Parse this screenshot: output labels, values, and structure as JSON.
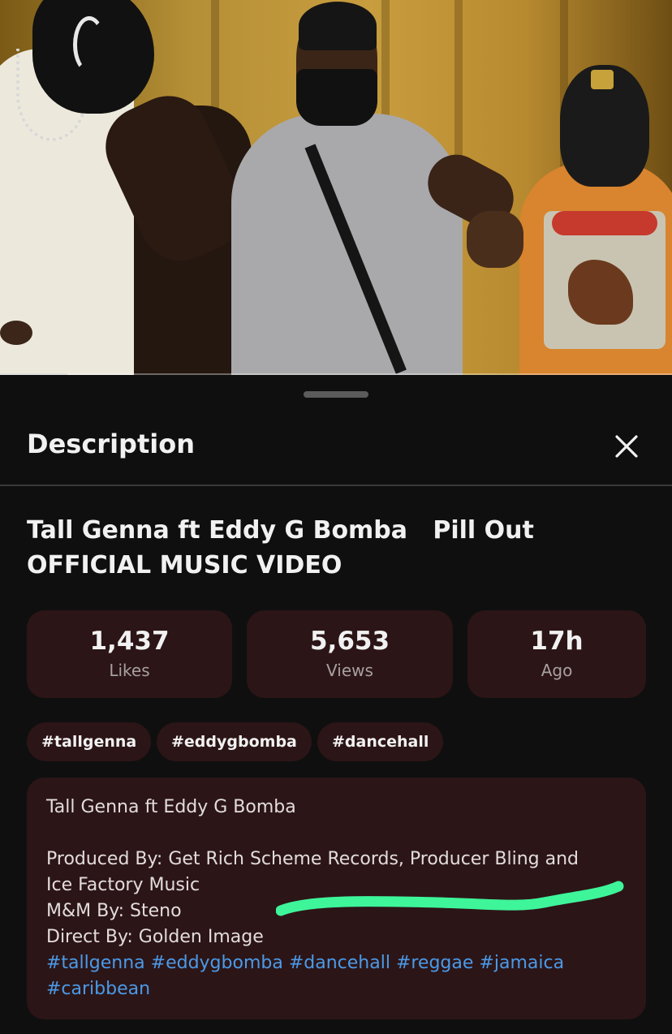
{
  "video": {
    "progress": 0.1
  },
  "sheet": {
    "title": "Description",
    "close_icon": "close-icon"
  },
  "video_title": "Tall Genna ft Eddy G Bomba   Pill Out OFFICIAL MUSIC VIDEO",
  "stats": [
    {
      "value": "1,437",
      "label": "Likes"
    },
    {
      "value": "5,653",
      "label": "Views"
    },
    {
      "value": "17h",
      "label": "Ago"
    }
  ],
  "tags": [
    "#tallgenna",
    "#eddygbomba",
    "#dancehall"
  ],
  "description": {
    "line1": "Tall Genna ft Eddy G Bomba",
    "line2": "Produced By: Get Rich Scheme Records, Producer Bling and",
    "line3": "Ice Factory Music",
    "line4": "M&M By: Steno",
    "line5": "Direct By: Golden Image",
    "hashtags_row1": [
      "#tallgenna",
      "#eddygbomba",
      "#dancehall",
      "#reggae",
      "#jamaica"
    ],
    "hashtags_row2": [
      "#caribbean"
    ]
  },
  "colors": {
    "sheet_bg": "#0f0f0f",
    "card_bg": "#2c1517",
    "hashtag_blue": "#4a9ae8",
    "highlight_green": "#3ef59a"
  }
}
